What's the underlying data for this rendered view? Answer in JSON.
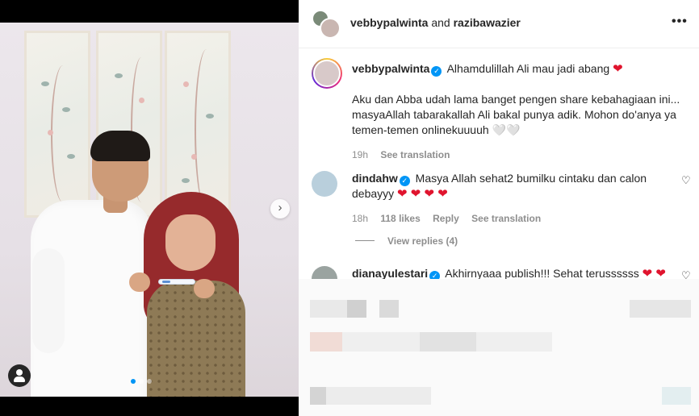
{
  "post": {
    "header": {
      "owner": "vebbypalwinta",
      "joiner": "and",
      "collaborator": "razibawazier",
      "more_icon": "more-horizontal-icon"
    },
    "caption": {
      "username": "vebbypalwinta",
      "headline": "Alhamdulillah Ali mau jadi abang",
      "heart": "❤",
      "body": "Aku dan Abba udah lama banget pengen share kebahagiaan ini... masyaAllah tabarakallah Ali bakal punya adik. Mohon do'anya ya temen-temen onlinekuuuuh 🤍🤍",
      "time": "19h",
      "see_translation": "See translation"
    },
    "comments": [
      {
        "username": "dindahw",
        "text": "Masya Allah sehat2 bumilku cintaku dan calon debayyy",
        "hearts": "❤ ❤ ❤ ❤",
        "time": "18h",
        "likes": "118 likes",
        "reply": "Reply",
        "see_translation": "See translation",
        "view_replies": "View replies (4)"
      },
      {
        "username": "dianayulestari",
        "text": "Akhirnyaaa publish!!! Sehat terussssss",
        "hearts": "❤ ❤"
      }
    ],
    "carousel": {
      "next_icon": "chevron-right-icon",
      "tag_icon": "user-tag-icon",
      "total_slides": 3,
      "active_slide": 1
    }
  },
  "colors": {
    "accent_blue": "#0095f6",
    "heart_red": "#e0142e",
    "text_primary": "#262626",
    "text_secondary": "#8e8e8e"
  }
}
